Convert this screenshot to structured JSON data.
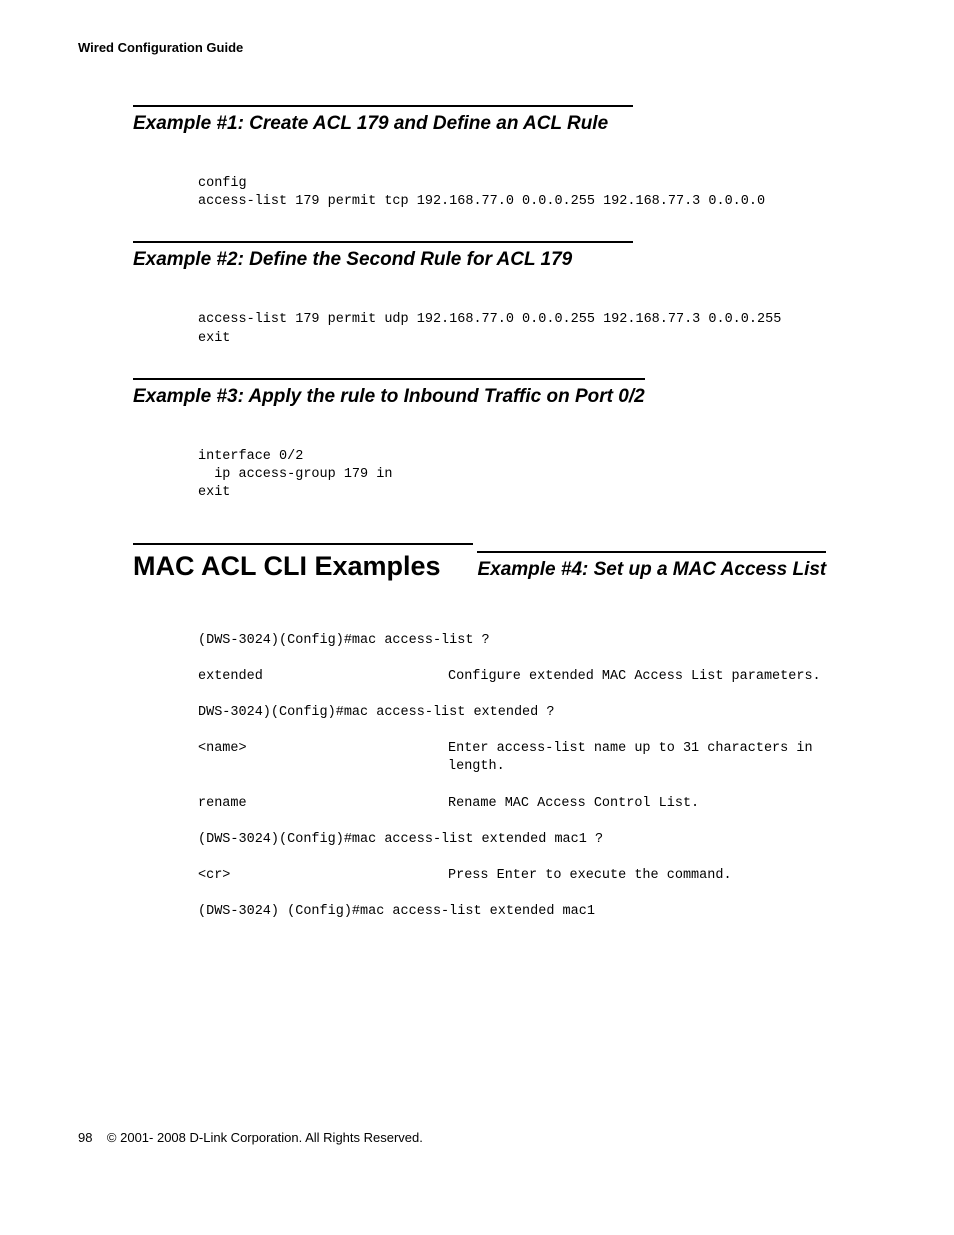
{
  "header": "Wired Configuration Guide",
  "ex1": {
    "title": "Example #1: Create ACL 179 and Define an ACL Rule",
    "code": "config\naccess-list 179 permit tcp 192.168.77.0 0.0.0.255 192.168.77.3 0.0.0.0"
  },
  "ex2": {
    "title": "Example #2: Define the Second Rule for ACL 179",
    "code": "access-list 179 permit udp 192.168.77.0 0.0.0.255 192.168.77.3 0.0.0.255\nexit"
  },
  "ex3": {
    "title": "Example #3: Apply the rule to Inbound Traffic on Port 0/2",
    "code": "interface 0/2\n  ip access-group 179 in\nexit"
  },
  "section": "MAC ACL CLI Examples",
  "ex4": {
    "title": "Example #4: Set up a MAC Access List",
    "line1": "(DWS-3024)(Config)#mac access-list ?",
    "row1_left": "extended",
    "row1_right": "Configure extended MAC Access List parameters.",
    "line2": "DWS-3024)(Config)#mac access-list extended ?",
    "row2_left": "<name>",
    "row2_right": "Enter access-list name up to 31 characters in length.",
    "row3_left": "rename",
    "row3_right": "Rename MAC Access Control List.",
    "line3": "(DWS-3024)(Config)#mac access-list extended mac1 ?",
    "row4_left": "<cr>",
    "row4_right": "Press Enter to execute the command.",
    "line4": "(DWS-3024) (Config)#mac access-list extended mac1"
  },
  "footer": {
    "page": "98",
    "copyright": "© 2001- 2008 D-Link Corporation. All Rights Reserved."
  }
}
